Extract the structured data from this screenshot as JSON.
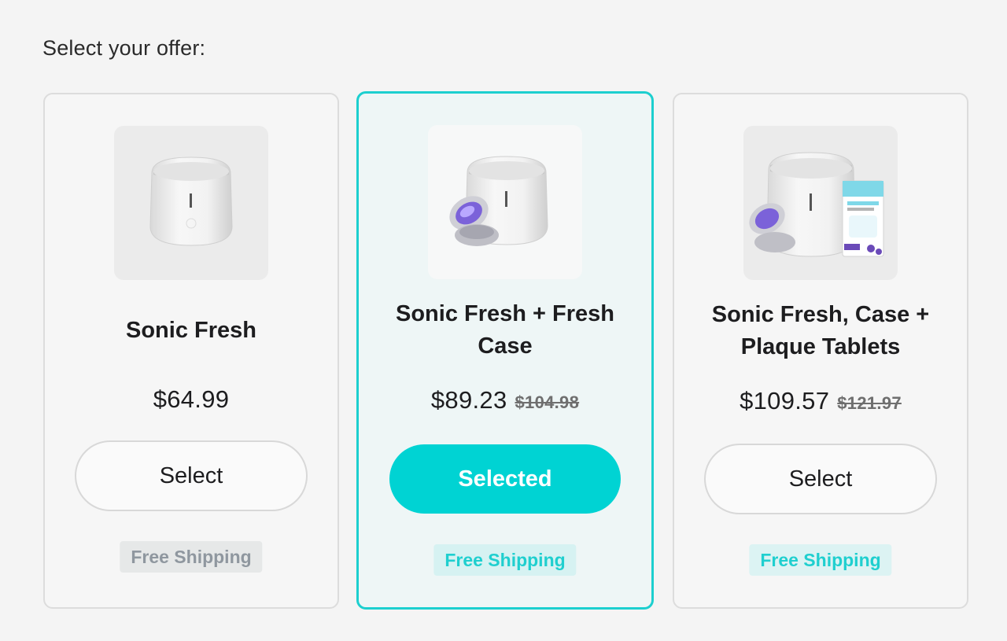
{
  "heading": "Select your offer:",
  "colors": {
    "accent": "#00d3d3",
    "free_shipping_active": "#1fcfcf",
    "free_shipping_inactive": "#8f979f"
  },
  "offers": [
    {
      "title": "Sonic Fresh",
      "price": "$64.99",
      "old_price": "",
      "button_label": "Select",
      "selected": false,
      "shipping_label": "Free Shipping",
      "image_icon": "sonic-fresh-device-icon"
    },
    {
      "title": "Sonic Fresh + Fresh Case",
      "price": "$89.23",
      "old_price": "$104.98",
      "button_label": "Selected",
      "selected": true,
      "shipping_label": "Free Shipping",
      "image_icon": "sonic-fresh-with-case-icon"
    },
    {
      "title": "Sonic Fresh, Case + Plaque Tablets",
      "price": "$109.57",
      "old_price": "$121.97",
      "button_label": "Select",
      "selected": false,
      "shipping_label": "Free Shipping",
      "image_icon": "sonic-fresh-bundle-icon"
    }
  ]
}
